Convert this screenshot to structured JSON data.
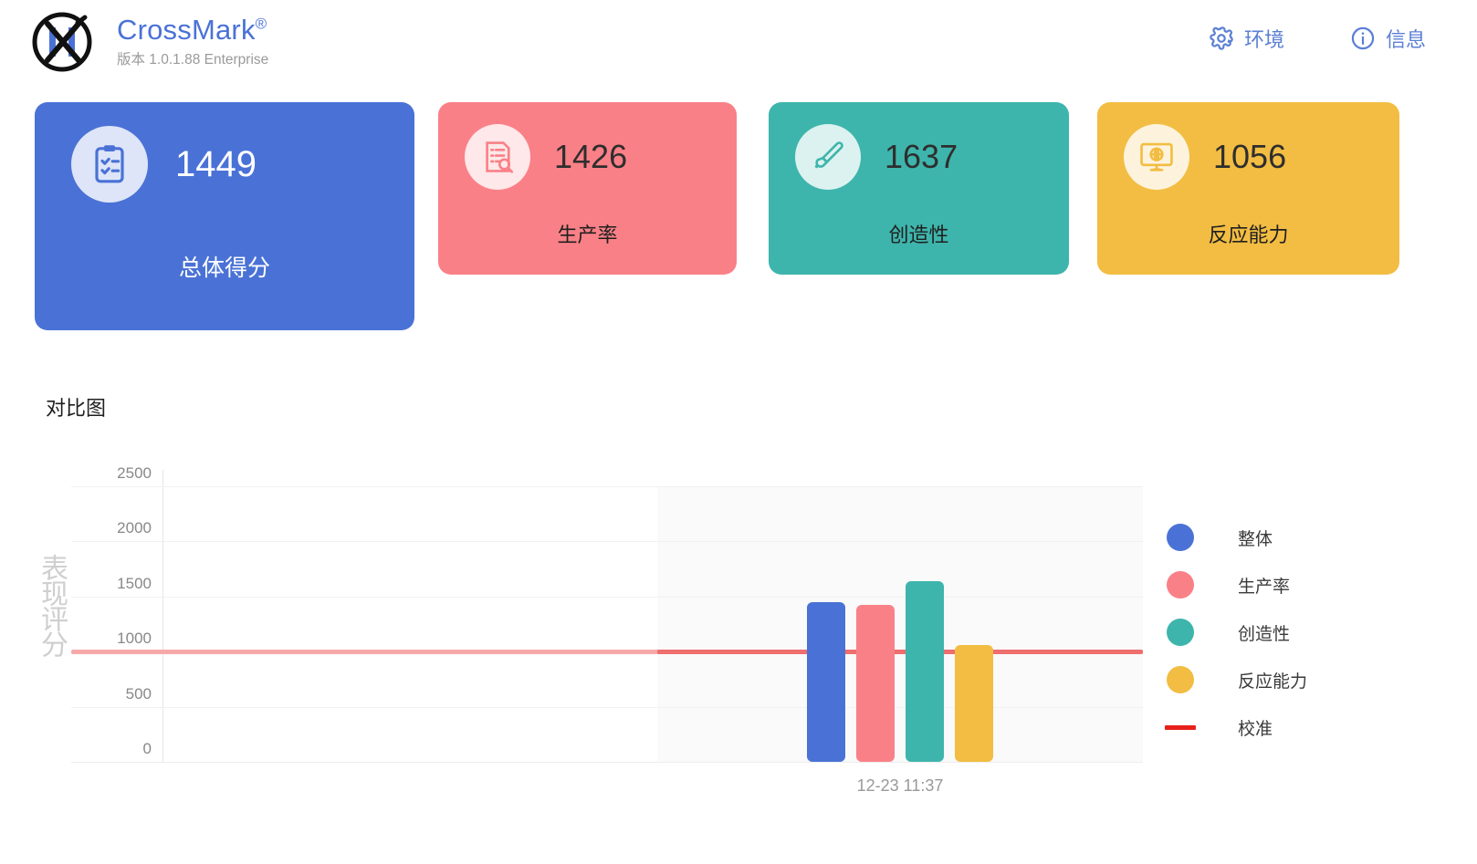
{
  "header": {
    "logo_icon": "crossmark-logo-icon",
    "brand_name": "CrossMark",
    "brand_trademark": "®",
    "version": "版本 1.0.1.88 Enterprise",
    "actions": [
      {
        "icon": "gear-icon",
        "label": "环境"
      },
      {
        "icon": "info-circle-icon",
        "label": "信息"
      }
    ]
  },
  "cards": [
    {
      "icon": "clipboard-check-icon",
      "score": "1449",
      "label": "总体得分",
      "color": "#4a72d6"
    },
    {
      "icon": "document-search-icon",
      "score": "1426",
      "label": "生产率",
      "color": "#fa8087"
    },
    {
      "icon": "paintbrush-icon",
      "score": "1637",
      "label": "创造性",
      "color": "#3eb5ac"
    },
    {
      "icon": "monitor-globe-icon",
      "score": "1056",
      "label": "反应能力",
      "color": "#f2bd42"
    }
  ],
  "chart": {
    "title": "对比图"
  },
  "chart_data": {
    "type": "bar",
    "title": "对比图",
    "xlabel": "",
    "ylabel": "表现评分",
    "categories": [
      "12-23 11:37"
    ],
    "ylim": [
      0,
      2500
    ],
    "yticks": [
      2500,
      2000,
      1500,
      1000,
      500,
      0
    ],
    "ytick_labels": [
      "2500",
      "2000",
      "1500",
      "1000",
      "500",
      "0"
    ],
    "grid": true,
    "legend_position": "right",
    "series": [
      {
        "name": "整体",
        "color": "#4a72d6",
        "values": [
          1449
        ]
      },
      {
        "name": "生产率",
        "color": "#fa8087",
        "values": [
          1426
        ]
      },
      {
        "name": "创造性",
        "color": "#3eb5ac",
        "values": [
          1637
        ]
      },
      {
        "name": "反应能力",
        "color": "#f2bd42",
        "values": [
          1056
        ]
      }
    ],
    "reference_line": {
      "name": "校准",
      "value": 1000,
      "color": "#ef6e6e"
    },
    "legend": [
      {
        "label": "整体",
        "color": "#4a72d6",
        "marker": "dot"
      },
      {
        "label": "生产率",
        "color": "#fa8087",
        "marker": "dot"
      },
      {
        "label": "创造性",
        "color": "#3eb5ac",
        "marker": "dot"
      },
      {
        "label": "反应能力",
        "color": "#f2bd42",
        "marker": "dot"
      },
      {
        "label": "校准",
        "color": "#e8201a",
        "marker": "line"
      }
    ]
  }
}
